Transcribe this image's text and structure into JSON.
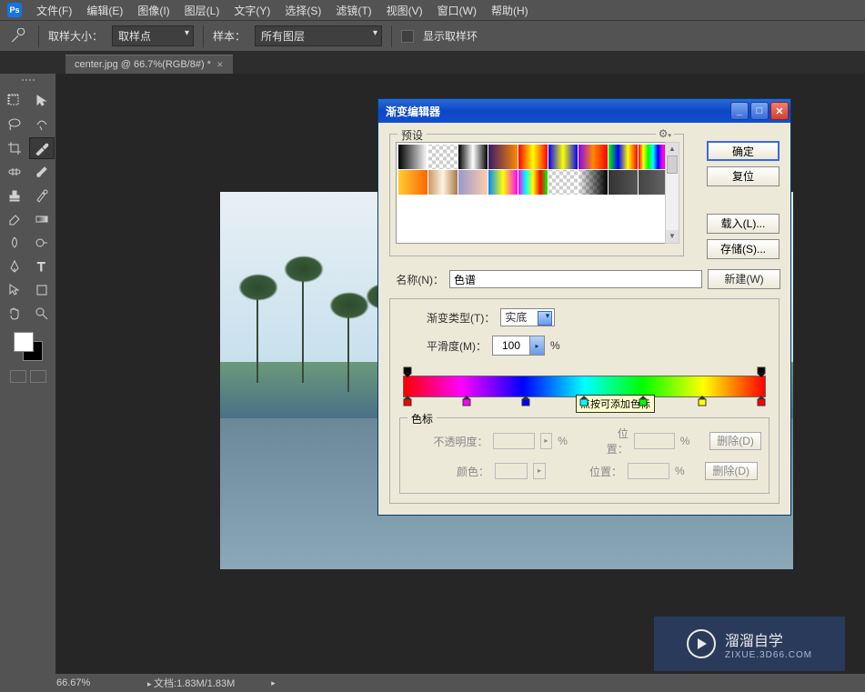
{
  "menubar": {
    "items": [
      "文件(F)",
      "编辑(E)",
      "图像(I)",
      "图层(L)",
      "文字(Y)",
      "选择(S)",
      "滤镜(T)",
      "视图(V)",
      "窗口(W)",
      "帮助(H)"
    ]
  },
  "optionsbar": {
    "sample_size_label": "取样大小：",
    "sample_size_value": "取样点",
    "sample_label": "样本：",
    "sample_value": "所有图层",
    "show_ring_label": "显示取样环"
  },
  "tab": {
    "title": "center.jpg @ 66.7%(RGB/8#) *"
  },
  "statusbar": {
    "zoom": "66.67%",
    "docinfo": "文档:1.83M/1.83M"
  },
  "dialog": {
    "title": "渐变编辑器",
    "presets_label": "预设",
    "ok": "确定",
    "reset": "复位",
    "load": "载入(L)...",
    "save": "存储(S)...",
    "name_label": "名称(N)：",
    "name_value": "色谱",
    "new_btn": "新建(W)",
    "type_label": "渐变类型(T)：",
    "type_value": "实底",
    "smooth_label": "平滑度(M)：",
    "smooth_value": "100",
    "smooth_unit": "%",
    "tooltip": "点按可添加色标",
    "colorstops_label": "色标",
    "opacity_label": "不透明度：",
    "position_label": "位置：",
    "color_label": "颜色：",
    "delete_label": "删除(D)",
    "percent": "%",
    "preset_styles": [
      "linear-gradient(90deg,#000,#fff)",
      "repeating-conic-gradient(#ccc 0 25%,#fff 0 50%) 0/8px 8px,linear-gradient(90deg,#000,transparent)",
      "linear-gradient(90deg,#000,#fff,#000)",
      "linear-gradient(90deg,#3a1a6a,#ff8800)",
      "linear-gradient(90deg,#ff0000,#ffff00,#ff0000)",
      "linear-gradient(90deg,#0000ff,#ffff00,#0000ff)",
      "linear-gradient(90deg,#8800ff,#ff8800,#ff0000)",
      "linear-gradient(90deg,#00ff00,#0000ff,#ffff00,#ff0000)",
      "linear-gradient(90deg,#ff0000,#ffff00,#00ff00,#00ffff,#0000ff,#ff00ff,#ff0000)",
      "linear-gradient(90deg,#ffcc33,#ff6600)",
      "linear-gradient(90deg,#c89868,#fff3e0,#a87848)",
      "linear-gradient(90deg,#9999cc,#ffccaa)",
      "linear-gradient(90deg,#0088ff,#ffff00,#ff00ff)",
      "linear-gradient(90deg,#ff00ff,#00ffff,#ffff00,#ff0000,#00ff00)",
      "repeating-conic-gradient(#ccc 0 25%,#fff 0 50%) 0/8px 8px",
      "linear-gradient(90deg,transparent,#000),repeating-conic-gradient(#ccc 0 25%,#fff 0 50%) 0/8px 8px",
      "linear-gradient(90deg,#333,#555)",
      "linear-gradient(90deg,#444,#666)"
    ],
    "bottom_stop_colors": [
      "#ff0000",
      "#ff00ff",
      "#0000ff",
      "#00ffff",
      "#00ff00",
      "#ffff00",
      "#ff0000"
    ]
  },
  "watermark": {
    "main": "溜溜自学",
    "sub": "ZIXUE.3D66.COM"
  }
}
